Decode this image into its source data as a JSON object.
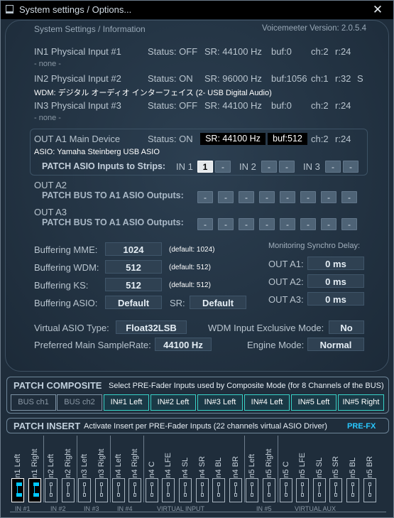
{
  "window": {
    "title": "System settings / Options...",
    "close_label": "✕"
  },
  "header": {
    "section_title": "System Settings / Information",
    "version": "Voicemeeter Version: 2.0.5.4"
  },
  "inputs": [
    {
      "label": "IN1 Physical Input #1",
      "status": "Status: OFF",
      "sr": "SR: 44100 Hz",
      "buf": "buf:0",
      "ch": "ch:2",
      "r": "r:24",
      "extra": "",
      "device": "- none -"
    },
    {
      "label": "IN2 Physical Input #2",
      "status": "Status: ON",
      "sr": "SR: 96000 Hz",
      "buf": "buf:1056",
      "ch": "ch:1",
      "r": "r:32",
      "extra": "S",
      "device": "WDM: デジタル オーディオ インターフェイス (2- USB Digital Audio)"
    },
    {
      "label": "IN3 Physical Input #3",
      "status": "Status: OFF",
      "sr": "SR: 44100 Hz",
      "buf": "buf:0",
      "ch": "ch:2",
      "r": "r:24",
      "extra": "",
      "device": "- none -"
    }
  ],
  "out_a1": {
    "label": "OUT A1 Main Device",
    "status": "Status: ON",
    "sr": "SR: 44100 Hz",
    "buf": "buf:512",
    "ch": "ch:2",
    "r": "r:24",
    "device": "ASIO: Yamaha Steinberg USB ASIO",
    "patch_label": "PATCH ASIO Inputs to Strips:",
    "strips": [
      {
        "name": "IN 1",
        "buttons": [
          "1",
          "-"
        ]
      },
      {
        "name": "IN 2",
        "buttons": [
          "-",
          "-"
        ]
      },
      {
        "name": "IN 3",
        "buttons": [
          "-",
          "-"
        ]
      }
    ]
  },
  "out_a2": {
    "label": "OUT A2",
    "patch_label": "PATCH BUS TO A1 ASIO Outputs:",
    "buttons": [
      "-",
      "-",
      "-",
      "-",
      "-",
      "-",
      "-",
      "-"
    ]
  },
  "out_a3": {
    "label": "OUT A3",
    "patch_label": "PATCH BUS TO A1 ASIO Outputs:",
    "buttons": [
      "-",
      "-",
      "-",
      "-",
      "-",
      "-",
      "-",
      "-"
    ]
  },
  "buffering": [
    {
      "label": "Buffering MME:",
      "value": "1024",
      "default": "(default: 1024)"
    },
    {
      "label": "Buffering WDM:",
      "value": "512",
      "default": "(default: 512)"
    },
    {
      "label": "Buffering KS:",
      "value": "512",
      "default": "(default: 512)"
    }
  ],
  "buffering_asio": {
    "label": "Buffering ASIO:",
    "value": "Default",
    "sr_label": "SR:",
    "sr_value": "Default"
  },
  "monitoring": {
    "title": "Monitoring Synchro Delay:",
    "rows": [
      {
        "label": "OUT A1:",
        "value": "0 ms"
      },
      {
        "label": "OUT A2:",
        "value": "0 ms"
      },
      {
        "label": "OUT A3:",
        "value": "0 ms"
      }
    ]
  },
  "virtual_asio": {
    "label": "Virtual ASIO Type:",
    "value": "Float32LSB"
  },
  "wdm_exclusive": {
    "label": "WDM Input Exclusive Mode:",
    "value": "No"
  },
  "preferred_sr": {
    "label": "Preferred Main SampleRate:",
    "value": "44100 Hz"
  },
  "engine_mode": {
    "label": "Engine Mode:",
    "value": "Normal"
  },
  "patch_composite": {
    "title": "PATCH COMPOSITE",
    "description": "Select PRE-Fader Inputs used by Composite Mode (for 8 Channels of the BUS)",
    "buttons": [
      {
        "label": "BUS ch1",
        "active": false
      },
      {
        "label": "BUS ch2",
        "active": false
      },
      {
        "label": "IN#1 Left",
        "active": true
      },
      {
        "label": "IN#2 Left",
        "active": true
      },
      {
        "label": "IN#3 Left",
        "active": true
      },
      {
        "label": "IN#4 Left",
        "active": true
      },
      {
        "label": "IN#5 Left",
        "active": true
      },
      {
        "label": "IN#5 Right",
        "active": true
      }
    ]
  },
  "patch_insert": {
    "title": "PATCH INSERT",
    "description": "Activate Insert per PRE-Fader Inputs (22 channels virtual ASIO Driver)",
    "prefx": "PRE-FX",
    "channels": [
      {
        "label": "in1 Left",
        "on": true
      },
      {
        "label": "in1 Right",
        "on": true
      },
      {
        "label": "in2 Left",
        "on": false
      },
      {
        "label": "in2 Right",
        "on": false
      },
      {
        "label": "in3 Left",
        "on": false
      },
      {
        "label": "in3 Right",
        "on": false
      },
      {
        "label": "in4 Left",
        "on": false
      },
      {
        "label": "in4 Right",
        "on": false
      },
      {
        "label": "in4 C",
        "on": false
      },
      {
        "label": "in4 LFE",
        "on": false
      },
      {
        "label": "in4 SL",
        "on": false
      },
      {
        "label": "in4 SR",
        "on": false
      },
      {
        "label": "in4 BL",
        "on": false
      },
      {
        "label": "in4 BR",
        "on": false
      },
      {
        "label": "in5 Left",
        "on": false
      },
      {
        "label": "in5 Right",
        "on": false
      },
      {
        "label": "in5 C",
        "on": false
      },
      {
        "label": "in5 LFE",
        "on": false
      },
      {
        "label": "in5 SL",
        "on": false
      },
      {
        "label": "in5 SR",
        "on": false
      },
      {
        "label": "in5 BL",
        "on": false
      },
      {
        "label": "in5 BR",
        "on": false
      }
    ],
    "groups": [
      "IN #1",
      "IN #2",
      "IN #3",
      "IN #4",
      "VIRTUAL INPUT",
      "IN #5",
      "VIRTUAL AUX"
    ]
  }
}
